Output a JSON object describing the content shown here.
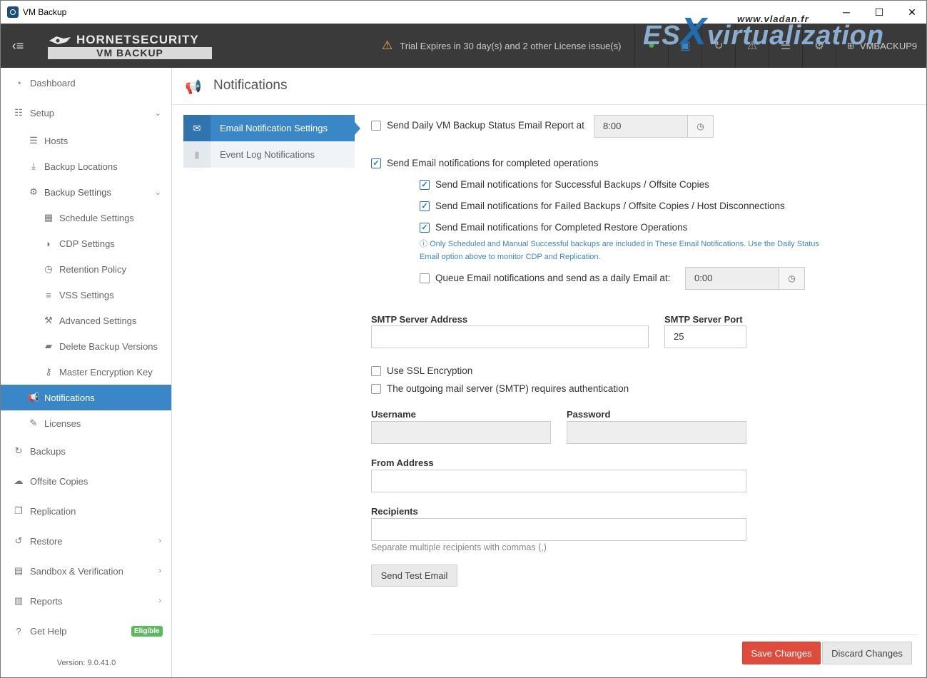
{
  "window": {
    "title": "VM Backup",
    "min": "─",
    "max": "☐",
    "close": "✕"
  },
  "topbar": {
    "logo_top": "HORNETSECURITY",
    "logo_bottom": "VM BACKUP",
    "trial_text": "Trial Expires in 30 day(s) and 2 other License issue(s)",
    "host": "VMBACKUP9",
    "icons": [
      "chat-icon",
      "monitor-icon",
      "refresh-icon",
      "alert-icon",
      "server-icon",
      "gears-icon"
    ]
  },
  "watermark": {
    "es": "ES",
    "x": "X",
    "virt": "virtualization",
    "url": "www.vladan.fr"
  },
  "sidebar": {
    "items": [
      {
        "label": "Dashboard"
      },
      {
        "label": "Setup"
      },
      {
        "label": "Hosts"
      },
      {
        "label": "Backup Locations"
      },
      {
        "label": "Backup Settings"
      },
      {
        "label": "Schedule Settings"
      },
      {
        "label": "CDP Settings"
      },
      {
        "label": "Retention Policy"
      },
      {
        "label": "VSS Settings"
      },
      {
        "label": "Advanced Settings"
      },
      {
        "label": "Delete Backup Versions"
      },
      {
        "label": "Master Encryption Key"
      },
      {
        "label": "Notifications"
      },
      {
        "label": "Licenses"
      },
      {
        "label": "Backups"
      },
      {
        "label": "Offsite Copies"
      },
      {
        "label": "Replication"
      },
      {
        "label": "Restore"
      },
      {
        "label": "Sandbox & Verification"
      },
      {
        "label": "Reports"
      },
      {
        "label": "Get Help"
      }
    ],
    "help_badge": "Eligible",
    "version": "Version: 9.0.41.0"
  },
  "page": {
    "title": "Notifications"
  },
  "subnav": {
    "email": "Email Notification Settings",
    "eventlog": "Event Log Notifications"
  },
  "form": {
    "daily_report_label": "Send Daily VM Backup Status Email Report at",
    "daily_report_time": "8:00",
    "completed_ops_label": "Send Email notifications for completed operations",
    "successful_label": "Send Email notifications for Successful Backups / Offsite Copies",
    "failed_label": "Send Email notifications for Failed Backups / Offsite Copies / Host Disconnections",
    "restore_label": "Send Email notifications for Completed Restore Operations",
    "info_line1": "Only Scheduled and Manual Successful backups are included in These Email Notifications. Use the Daily Status",
    "info_line2": "Email option above to monitor CDP and Replication.",
    "queue_label": "Queue Email notifications and send as a daily Email at:",
    "queue_time": "0:00",
    "smtp_address_label": "SMTP Server Address",
    "smtp_address_value": "",
    "smtp_port_label": "SMTP Server Port",
    "smtp_port_value": "25",
    "ssl_label": "Use SSL Encryption",
    "auth_label": "The outgoing mail server (SMTP) requires authentication",
    "username_label": "Username",
    "password_label": "Password",
    "from_label": "From Address",
    "recipients_label": "Recipients",
    "recipients_help": "Separate multiple recipients with commas (,)",
    "test_button": "Send Test Email",
    "checked": {
      "daily": false,
      "completed": true,
      "successful": true,
      "failed": true,
      "restore": true,
      "queue": false,
      "ssl": false,
      "auth": false
    }
  },
  "footer": {
    "save": "Save Changes",
    "discard": "Discard Changes"
  },
  "colors": {
    "accent": "#3a87c8",
    "save": "#e04b3b",
    "badge": "#5cb85c",
    "topbar": "#3a3a3a"
  }
}
